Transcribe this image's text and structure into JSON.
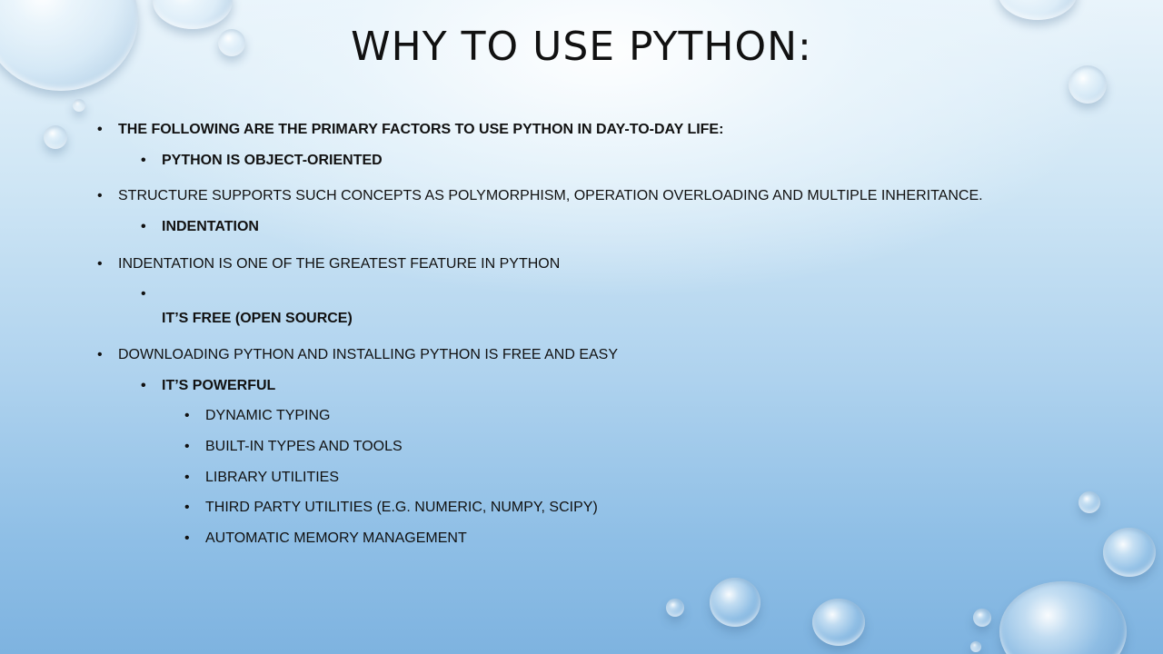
{
  "slide": {
    "title": "WHY TO USE PYTHON:",
    "bullet_char": "•",
    "items": [
      {
        "text": "THE FOLLOWING ARE THE PRIMARY FACTORS TO USE PYTHON IN DAY-TO-DAY LIFE:",
        "level": 1,
        "bold": true
      },
      {
        "text": "PYTHON IS OBJECT-ORIENTED",
        "level": 2,
        "bold": true
      },
      {
        "text": "STRUCTURE SUPPORTS SUCH CONCEPTS AS POLYMORPHISM, OPERATION OVERLOADING AND MULTIPLE INHERITANCE.",
        "level": 1,
        "bold": false
      },
      {
        "text": "INDENTATION",
        "level": 2,
        "bold": true
      },
      {
        "text": "INDENTATION IS ONE OF THE GREATEST FEATURE IN PYTHON",
        "level": 1,
        "bold": false
      },
      {
        "text": "",
        "level": 2,
        "bold": false
      },
      {
        "text": "IT’S FREE (OPEN SOURCE)",
        "level": 2,
        "bold": true,
        "no_bullet": true
      },
      {
        "text": "DOWNLOADING PYTHON AND INSTALLING PYTHON IS FREE AND EASY",
        "level": 1,
        "bold": false
      },
      {
        "text": "IT’S POWERFUL",
        "level": 2,
        "bold": true
      },
      {
        "text": "DYNAMIC TYPING",
        "level": 3,
        "bold": false
      },
      {
        "text": "BUILT-IN TYPES AND TOOLS",
        "level": 3,
        "bold": false
      },
      {
        "text": "LIBRARY UTILITIES",
        "level": 3,
        "bold": false
      },
      {
        "text": "THIRD PARTY UTILITIES (E.G. NUMERIC, NUMPY, SCIPY)",
        "level": 3,
        "bold": false
      },
      {
        "text": "AUTOMATIC MEMORY MANAGEMENT",
        "level": 3,
        "bold": false
      }
    ]
  }
}
